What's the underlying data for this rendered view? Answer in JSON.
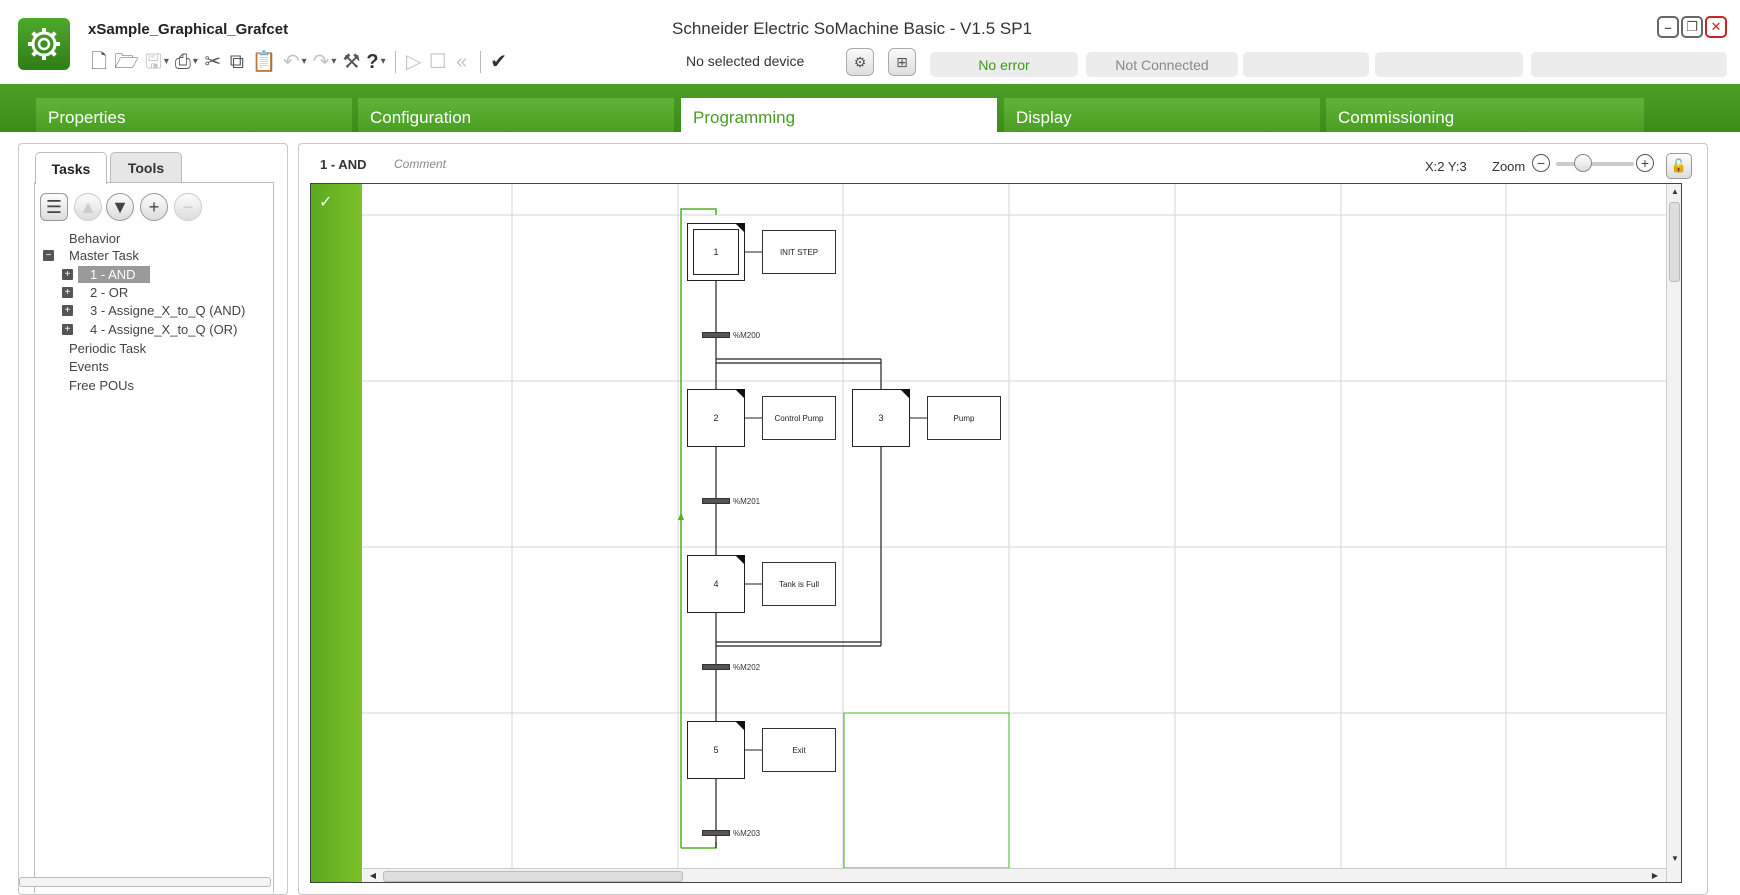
{
  "header": {
    "project_title": "xSample_Graphical_Grafcet",
    "window_title": "Schneider Electric SoMachine Basic - V1.5 SP1",
    "device_label": "No selected device",
    "status_error": "No error",
    "status_connection": "Not Connected",
    "colors": {
      "brand_green": "#4a9e22",
      "status_ok_text": "#3a9a1a",
      "status_off_text": "#888888"
    }
  },
  "toolbar": {
    "items": [
      "new-file-icon",
      "open-folder-icon",
      "save-icon",
      "print-icon",
      "cut-icon",
      "copy-icon",
      "paste-icon",
      "undo-icon",
      "redo-icon",
      "tools-icon",
      "help-icon",
      "run-icon",
      "stop-icon",
      "rewind-icon",
      "check-icon"
    ],
    "help_label": "?"
  },
  "nav": {
    "tabs": [
      {
        "label": "Properties",
        "active": false
      },
      {
        "label": "Configuration",
        "active": false
      },
      {
        "label": "Programming",
        "active": true
      },
      {
        "label": "Display",
        "active": false
      },
      {
        "label": "Commissioning",
        "active": false
      }
    ]
  },
  "left_panel": {
    "tabs": [
      {
        "label": "Tasks",
        "active": true
      },
      {
        "label": "Tools",
        "active": false
      }
    ],
    "tree": {
      "behavior": "Behavior",
      "master_task": "Master Task",
      "master_children": [
        "1 - AND",
        "2 - OR",
        "3 - Assigne_X_to_Q (AND)",
        "4 - Assigne_X_to_Q (OR)"
      ],
      "periodic_task": "Periodic Task",
      "events": "Events",
      "free_pous": "Free POUs",
      "selected": "1 - AND"
    }
  },
  "editor": {
    "rung_title": "1 - AND",
    "rung_comment": "Comment",
    "coords": "X:2 Y:3",
    "zoom_label": "Zoom",
    "zoom_level": 0.3,
    "steps": [
      {
        "id": "1",
        "initial": true
      },
      {
        "id": "2",
        "initial": false
      },
      {
        "id": "3",
        "initial": false
      },
      {
        "id": "4",
        "initial": false
      },
      {
        "id": "5",
        "initial": false
      }
    ],
    "actions": [
      "INIT STEP",
      "Control Pump",
      "Pump",
      "Tank is Full",
      "Exit"
    ],
    "transitions": [
      "%M200",
      "%M201",
      "%M202",
      "%M203"
    ]
  }
}
